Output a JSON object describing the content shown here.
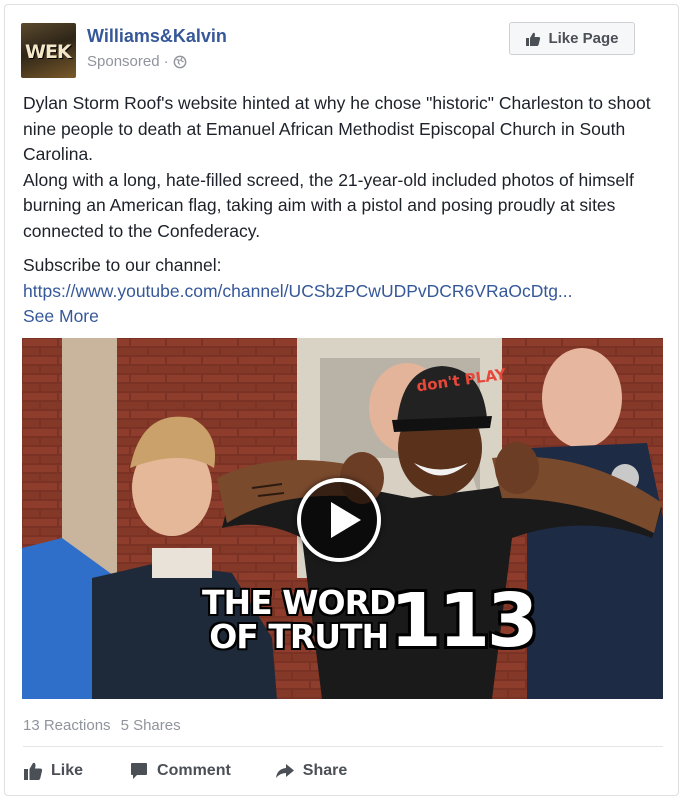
{
  "post": {
    "page_name": "Williams&Kalvin",
    "avatar_text": "WEK",
    "sponsored_label": "Sponsored",
    "sponsored_separator": "·",
    "like_page_label": "Like Page",
    "text_para1": "Dylan Storm Roof's website hinted at why he chose \"historic\" Charleston to shoot nine people to death at Emanuel African Methodist Episcopal Church in South Carolina.",
    "text_para2": "Along with a long, hate-filled screed, the 21-year-old included photos of himself burning an American flag, taking aim with a pistol and posing proudly at sites connected to the Confederacy.",
    "subscribe_label": "Subscribe to our channel:",
    "channel_link": "https://www.youtube.com/channel/UCSbzPCwUDPvDCR6VRaOcDtg...",
    "see_more": "See More"
  },
  "video": {
    "hat_text": "don't PLAY",
    "title_line1": "THE WORD",
    "title_line2": "OF TRUTH",
    "episode_number": "113"
  },
  "footer": {
    "reactions": "13 Reactions",
    "shares": "5 Shares",
    "like_label": "Like",
    "comment_label": "Comment",
    "share_label": "Share"
  },
  "colors": {
    "link": "#365899",
    "muted": "#90949c",
    "action_text": "#4b4f56"
  }
}
